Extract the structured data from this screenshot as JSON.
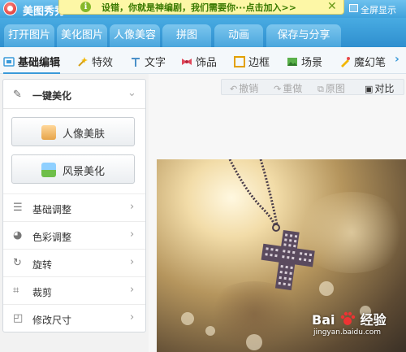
{
  "app": {
    "title": "美图秀秀",
    "fullscreen_label": "全屏显示"
  },
  "banner": {
    "text": "设错，你就是神编剧，我们需要你···点击加入>>",
    "close_glyph": "✕"
  },
  "main_tabs": [
    {
      "label": "打开图片",
      "active": false
    },
    {
      "label": "美化图片",
      "active": false
    },
    {
      "label": "人像美容",
      "active": false
    },
    {
      "label": "拼图",
      "active": false
    },
    {
      "label": "动画",
      "active": false
    },
    {
      "label": "保存与分享",
      "active": false
    }
  ],
  "sub_tabs": [
    {
      "label": "基础编辑",
      "icon": "edit-icon",
      "active": true
    },
    {
      "label": "特效",
      "icon": "effects-icon",
      "active": false
    },
    {
      "label": "文字",
      "icon": "text-icon",
      "active": false
    },
    {
      "label": "饰品",
      "icon": "accessory-icon",
      "active": false
    },
    {
      "label": "边框",
      "icon": "frame-icon",
      "active": false
    },
    {
      "label": "场景",
      "icon": "scene-icon",
      "active": false
    },
    {
      "label": "魔幻笔",
      "icon": "magic-pen-icon",
      "active": false
    }
  ],
  "edit_tools": {
    "undo": "撤销",
    "redo": "重做",
    "original": "原图",
    "compare": "对比"
  },
  "left_panel": {
    "one_key_label": "一键美化",
    "portrait_button": "人像美肤",
    "landscape_button": "风景美化",
    "menu": [
      {
        "label": "基础调整",
        "icon": "sliders-icon"
      },
      {
        "label": "色彩调整",
        "icon": "palette-icon"
      },
      {
        "label": "旋转",
        "icon": "rotate-icon"
      },
      {
        "label": "裁剪",
        "icon": "crop-icon"
      },
      {
        "label": "修改尺寸",
        "icon": "resize-icon"
      }
    ]
  },
  "watermark": {
    "brand_left": "Bai",
    "brand_right": "经验",
    "url": "jingyan.baidu.com"
  },
  "colors": {
    "titlebar": "#3fa2dc",
    "banner_bg": "#fdf7a6",
    "banner_text": "#3a7a00",
    "accent": "#3a9ad9"
  }
}
